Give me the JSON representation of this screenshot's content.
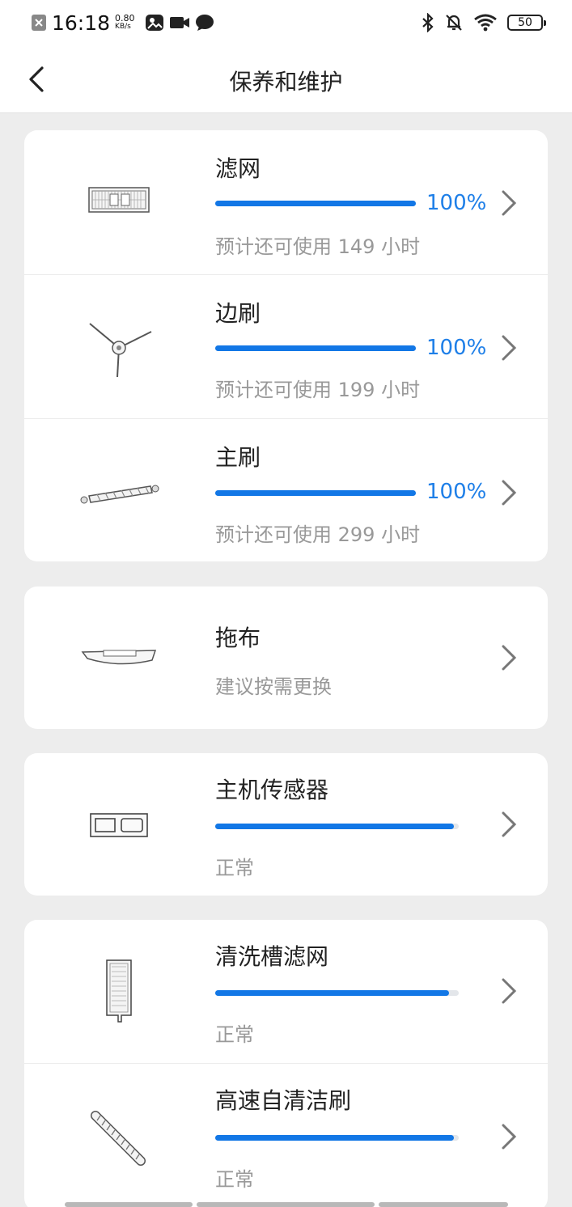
{
  "status_bar": {
    "time": "16:18",
    "speed_value": "0.80",
    "speed_unit": "KB/s",
    "battery": "50",
    "icons": [
      "close-notification-icon",
      "gallery-icon",
      "video-icon",
      "chat-bubble-icon",
      "bluetooth-icon",
      "bell-muted-icon",
      "wifi-icon",
      "battery-icon"
    ]
  },
  "header": {
    "title": "保养和维护",
    "back_icon": "chevron-left-icon"
  },
  "items": [
    {
      "name": "滤网",
      "percent_label": "100%",
      "progress": 1.0,
      "remaining": "预计还可使用 149 小时",
      "icon": "filter-icon"
    },
    {
      "name": "边刷",
      "percent_label": "100%",
      "progress": 1.0,
      "remaining": "预计还可使用 199 小时",
      "icon": "side-brush-icon"
    },
    {
      "name": "主刷",
      "percent_label": "100%",
      "progress": 1.0,
      "remaining": "预计还可使用 299 小时",
      "icon": "main-brush-icon"
    },
    {
      "name": "拖布",
      "remaining": "建议按需更换",
      "icon": "mop-icon"
    },
    {
      "name": "主机传感器",
      "progress": 0.98,
      "remaining": "正常",
      "icon": "sensor-icon"
    },
    {
      "name": "清洗槽滤网",
      "progress": 0.96,
      "remaining": "正常",
      "icon": "wash-tray-filter-icon"
    },
    {
      "name": "高速自清洁刷",
      "progress": 0.98,
      "remaining": "正常",
      "icon": "self-cleaning-brush-icon"
    }
  ],
  "colors": {
    "accent": "#1277e6",
    "percent_text": "#1e7fe8",
    "background": "#ededed",
    "card": "#ffffff"
  }
}
